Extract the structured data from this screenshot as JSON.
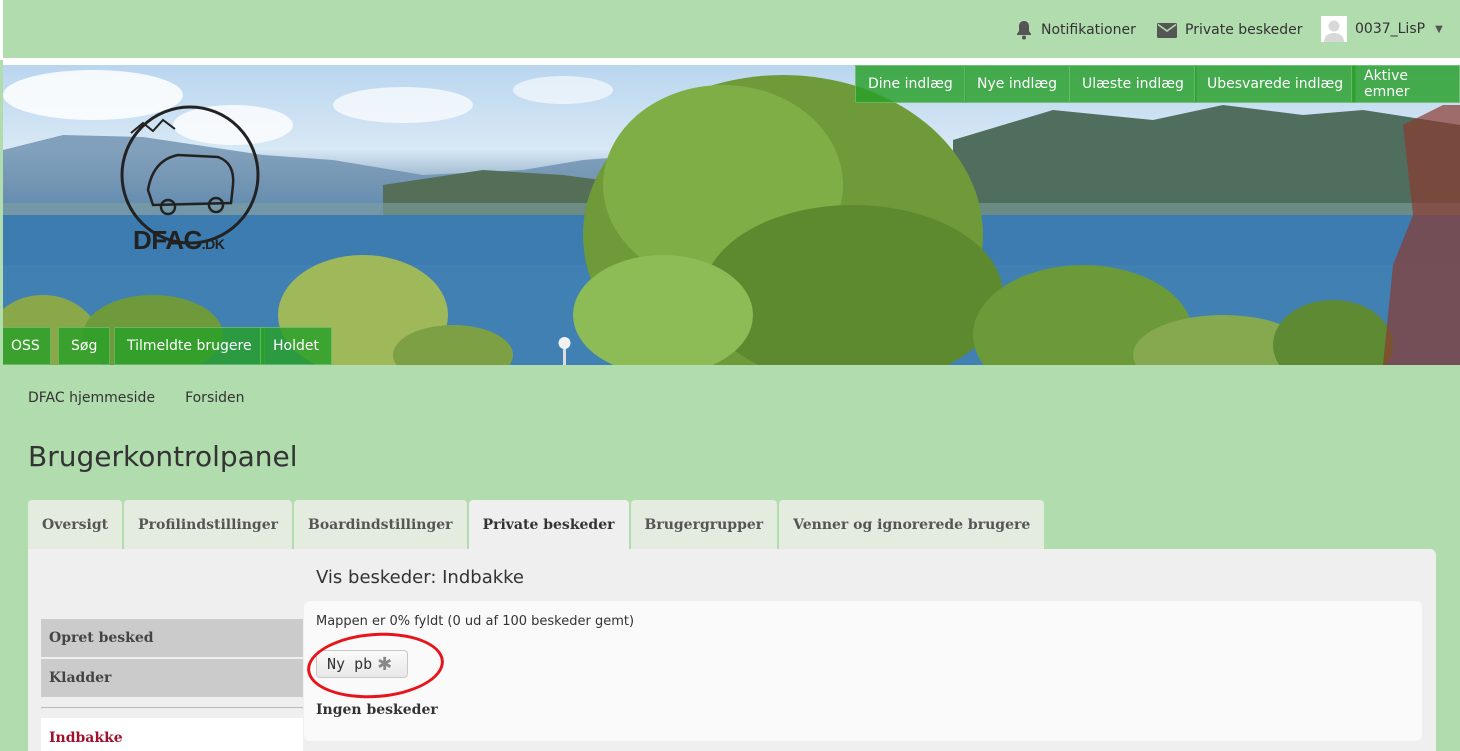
{
  "topbar": {
    "notifications_label": "Notifikationer",
    "private_messages_label": "Private beskeder",
    "username": "0037_LisP"
  },
  "banner": {
    "logo_text": "DFAC",
    "logo_suffix": ".DK",
    "quick_links": [
      "Dine indlæg",
      "Nye indlæg",
      "Ulæste indlæg",
      "Ubesvarede indlæg",
      "Aktive emner"
    ],
    "bottom_links": [
      "OSS",
      "Søg",
      "Tilmeldte brugere",
      "Holdet"
    ]
  },
  "breadcrumb": [
    "DFAC hjemmeside",
    "Forsiden"
  ],
  "page_title": "Brugerkontrolpanel",
  "tabs": [
    "Oversigt",
    "Profilindstillinger",
    "Boardindstillinger",
    "Private beskeder",
    "Brugergrupper",
    "Venner og ignorerede brugere"
  ],
  "sidebar": {
    "compose": "Opret besked",
    "drafts": "Kladder",
    "inbox": "Indbakke"
  },
  "content": {
    "title": "Vis beskeder: Indbakke",
    "folder_status": "Mappen er 0% fyldt (0 ud af 100 beskeder gemt)",
    "new_pm_button": "Ny pb",
    "no_messages": "Ingen beskeder"
  },
  "colors": {
    "page_bg": "#b0dcae",
    "nav_green": "#28a028",
    "highlight_red": "#e8141b",
    "inbox_link": "#a0122e"
  }
}
